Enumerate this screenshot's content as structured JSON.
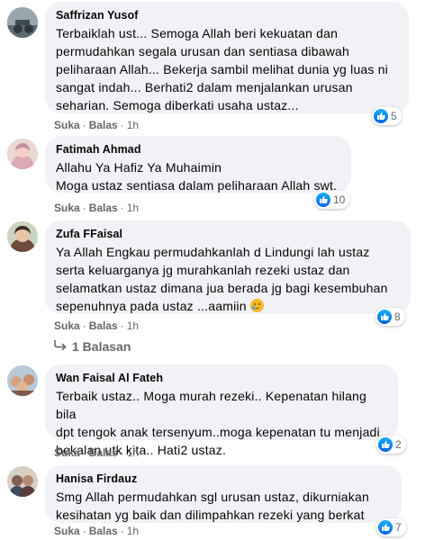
{
  "comments": [
    {
      "name": "Saffrizan Yusof",
      "text": "Terbaiklah ust... Semoga Allah beri kekuatan dan\npermudahkan segala urusan dan sentiasa dibawah\npeliharaan Allah... Bekerja sambil melihat dunia yg luas ni\nsangat indah... Berhati2 dalam menjalankan urusan\nseharian. Semoga diberkati usaha ustaz...",
      "like_label": "Suka",
      "reply_label": "Balas",
      "time": "1h",
      "reaction_count": "5",
      "reaction_icon": "like-icon"
    },
    {
      "name": "Fatimah Ahmad",
      "text": "Allahu Ya Hafiz Ya Muhaimin\nMoga ustaz sentiasa dalam peliharaan Allah swt.",
      "like_label": "Suka",
      "reply_label": "Balas",
      "time": "1h",
      "reaction_count": "10",
      "reaction_icon": "like-icon"
    },
    {
      "name": "Zufa FFaisal",
      "text": "Ya Allah Engkau permudahkanlah d Lindungi lah ustaz\nserta keluarganya jg murahkanlah rezeki ustaz dan\nselamatkan ustaz dimana jua berada jg bagi kesembuhan\nsepenuhnya pada ustaz ...aamiin",
      "like_label": "Suka",
      "reply_label": "Balas",
      "time": "1h",
      "reaction_count": "8",
      "reaction_icon": "like-icon",
      "replies_label": "1 Balasan"
    },
    {
      "name": "Wan Faisal Al Fateh",
      "text": "Terbaik ustaz.. Moga murah rezeki.. Kepenatan hilang bila\ndpt tengok anak tersenyum..moga kepenatan tu menjadi\nbekalan utk kita.. Hati2 ustaz.",
      "like_label": "Suka",
      "reply_label": "Balas",
      "time": "1h",
      "reaction_count": "2",
      "reaction_icon": "like-icon"
    },
    {
      "name": "Hanisa Firdauz",
      "text": "Smg Allah permudahkan sgl urusan ustaz, dikurniakan\nkesihatan yg baik dan dilimpahkan rezeki yang berkat",
      "like_label": "Suka",
      "reply_label": "Balas",
      "time": "1h",
      "reaction_count": "7",
      "reaction_icon": "like-icon"
    }
  ],
  "separator": "·",
  "colors": {
    "bubble": "#f0f2f5",
    "meta_text": "#65676b",
    "like_blue": "#1877f2"
  }
}
